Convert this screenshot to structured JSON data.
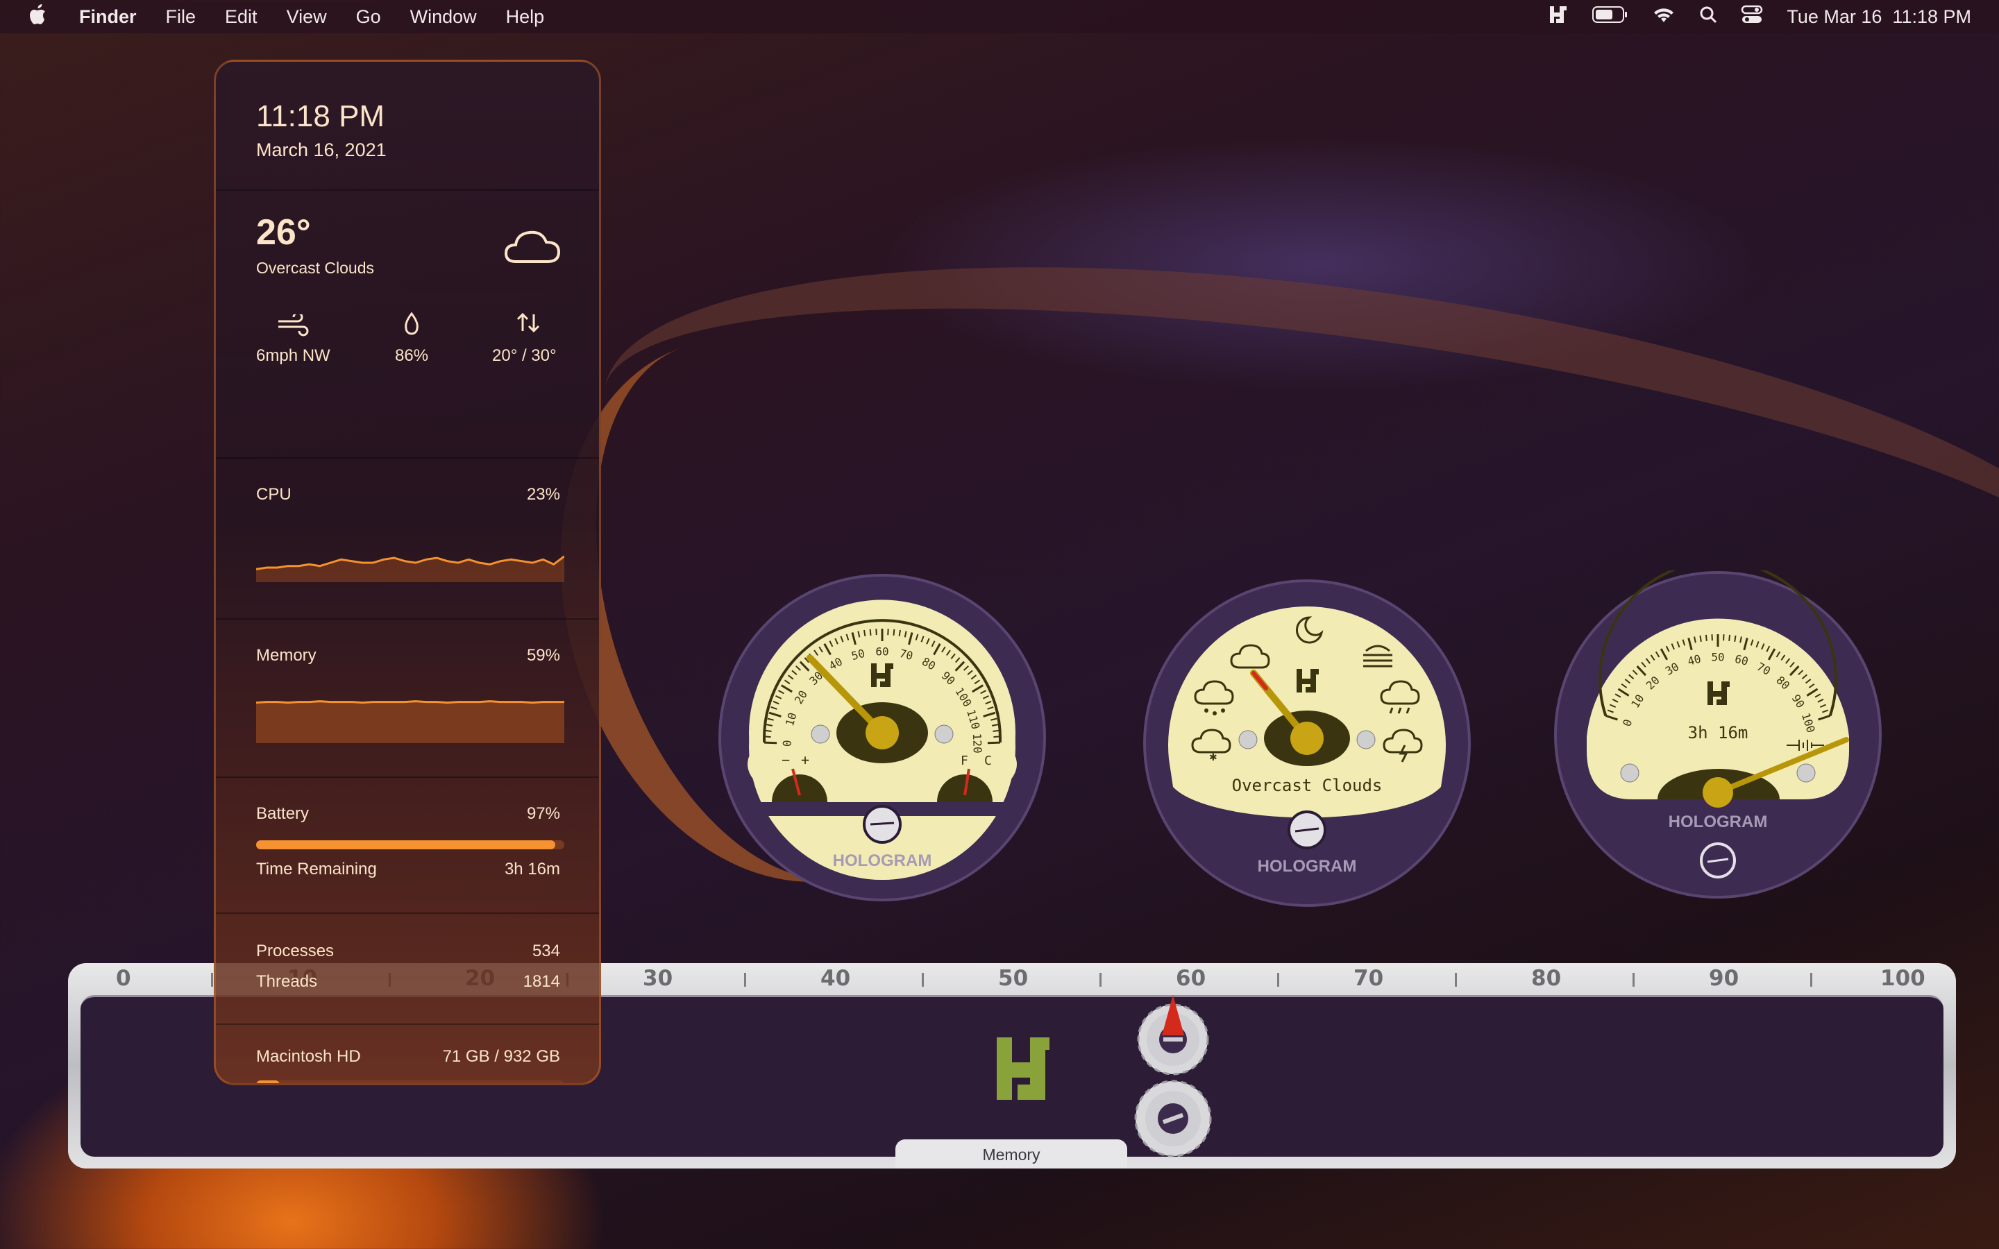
{
  "menubar": {
    "app": "Finder",
    "items": [
      "File",
      "Edit",
      "View",
      "Go",
      "Window",
      "Help"
    ],
    "clock": "Tue Mar 16  11:18 PM",
    "icons": [
      "hologram-icon",
      "battery-icon",
      "wifi-icon",
      "search-icon",
      "control-center-icon"
    ]
  },
  "widget": {
    "time": "11:18 PM",
    "date": "March 16, 2021",
    "weather": {
      "temp": "26°",
      "condition": "Overcast Clouds",
      "wind": "6mph NW",
      "humidity": "86%",
      "range": "20° / 30°"
    },
    "cpu": {
      "label": "CPU",
      "value": "23%",
      "history": [
        8,
        9,
        9,
        10,
        10,
        11,
        10,
        12,
        14,
        13,
        12,
        12,
        14,
        15,
        13,
        12,
        14,
        15,
        13,
        12,
        14,
        12,
        11,
        13,
        14,
        13,
        12,
        14,
        11,
        16
      ]
    },
    "memory": {
      "label": "Memory",
      "value": "59%",
      "history": [
        58,
        59,
        59,
        58,
        59,
        59,
        60,
        59,
        59,
        59,
        58,
        59,
        59,
        59,
        59,
        60,
        59,
        59,
        58,
        59,
        59,
        59,
        60,
        59,
        59,
        59,
        58,
        59,
        59,
        59
      ]
    },
    "battery": {
      "label": "Battery",
      "value": "97%",
      "level": 0.97,
      "remaining_label": "Time Remaining",
      "remaining": "3h 16m"
    },
    "processes": {
      "label": "Processes",
      "value": "534"
    },
    "threads": {
      "label": "Threads",
      "value": "1814"
    },
    "disk": {
      "label": "Macintosh HD",
      "value": "71 GB / 932 GB",
      "level": 0.076
    }
  },
  "gauges": {
    "brand": "HOLOGRAM",
    "cpu_scale": [
      "0",
      "10",
      "20",
      "30",
      "40",
      "50",
      "60",
      "70",
      "80",
      "90",
      "100",
      "110",
      "120"
    ],
    "cpu_needle": 30,
    "weather_text": "Overcast Clouds",
    "battery_scale": [
      "0",
      "10",
      "20",
      "30",
      "40",
      "50",
      "60",
      "70",
      "80",
      "90",
      "100"
    ],
    "battery_text": "3h 16m",
    "battery_needle": 97,
    "left_sub_labels": [
      "−",
      "+"
    ],
    "right_sub_labels": [
      "F",
      "C"
    ]
  },
  "ruler": {
    "ticks": [
      "0",
      "10",
      "20",
      "30",
      "40",
      "50",
      "60",
      "70",
      "80",
      "90",
      "100"
    ],
    "value": 59,
    "label": "Memory"
  },
  "colors": {
    "accent": "#f6922f",
    "gauge_face": "#f2ebb4",
    "gauge_rim": "#3e2b52",
    "hologram_green": "#8aa23a"
  }
}
